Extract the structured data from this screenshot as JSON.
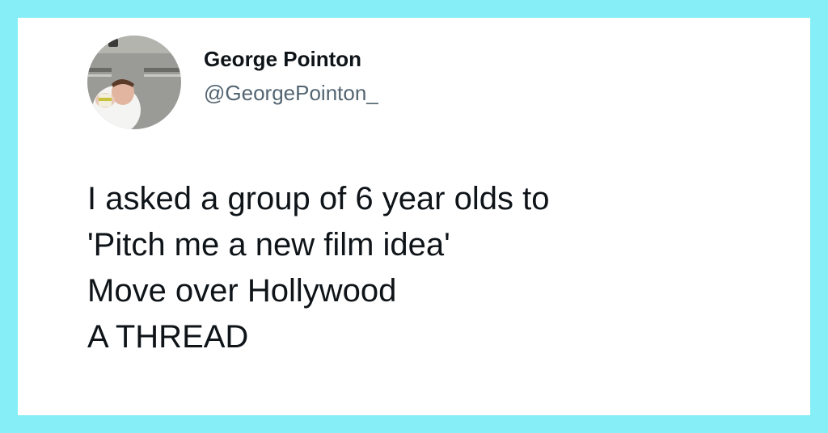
{
  "author": {
    "name": "George Pointon",
    "handle": "@GeorgePointon_"
  },
  "tweet": {
    "lines": [
      "I asked a group of 6 year olds to",
      "'Pitch me a new film idea'",
      "Move over Hollywood",
      "A THREAD"
    ]
  },
  "colors": {
    "background": "#85EEF6",
    "card": "#FFFFFF",
    "name_text": "#0F1419",
    "handle_text": "#536471"
  }
}
